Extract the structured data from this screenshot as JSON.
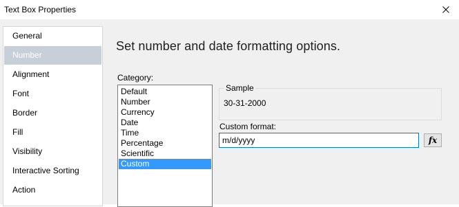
{
  "window": {
    "title": "Text Box Properties",
    "close_icon": "close-icon"
  },
  "sidebar": {
    "selected": "Number",
    "items": [
      {
        "label": "General"
      },
      {
        "label": "Number"
      },
      {
        "label": "Alignment"
      },
      {
        "label": "Font"
      },
      {
        "label": "Border"
      },
      {
        "label": "Fill"
      },
      {
        "label": "Visibility"
      },
      {
        "label": "Interactive Sorting"
      },
      {
        "label": "Action"
      }
    ]
  },
  "main": {
    "heading": "Set number and date formatting options.",
    "category": {
      "label": "Category:",
      "selected": "Custom",
      "items": [
        {
          "label": "Default"
        },
        {
          "label": "Number"
        },
        {
          "label": "Currency"
        },
        {
          "label": "Date"
        },
        {
          "label": "Time"
        },
        {
          "label": "Percentage"
        },
        {
          "label": "Scientific"
        },
        {
          "label": "Custom"
        }
      ]
    },
    "sample": {
      "label": "Sample",
      "value": "30-31-2000"
    },
    "custom_format": {
      "label": "Custom format:",
      "value": "m/d/yyyy"
    },
    "expression_button": {
      "label": "fx",
      "icon": "function-icon"
    }
  },
  "colors": {
    "selection_blue": "#3399ff",
    "sidebar_selected": "#c7cfd9",
    "input_focus_border": "#0078d7",
    "panel_background": "#f0f0f0"
  }
}
